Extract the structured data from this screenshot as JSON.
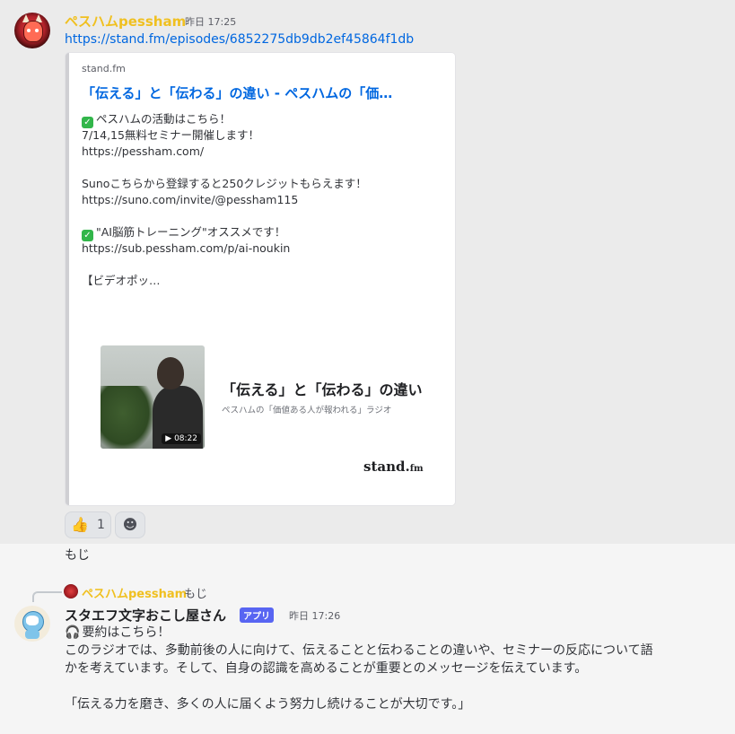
{
  "message1": {
    "username": "ペスハムpessham",
    "timestamp": "昨日 17:25",
    "link": "https://stand.fm/episodes/6852275db9db2ef45864f1db",
    "embed": {
      "provider": "stand.fm",
      "title": "「伝える」と「伝わる」の違い - ペスハムの「価…",
      "description_lines": [
        "ペスハムの活動はこちら！",
        "7/14,15無料セミナー開催します！",
        "https://pessham.com/",
        "",
        "Sunoこちらから登録すると250クレジットもらえます！",
        "https://suno.com/invite/@pessham115",
        "",
        "\"AI脳筋トレーニング\"オススメです！",
        "https://sub.pessham.com/p/ai-noukin",
        "",
        "【ビデオポッ…"
      ],
      "thumbnail": {
        "heading": "「伝える」と「伝わる」の違い",
        "subheading": "ペスハムの「価値ある人が報われる」ラジオ",
        "duration": "▶ 08:22",
        "logo": "stand.",
        "logo_small": "fm"
      }
    },
    "reactions": [
      {
        "emoji": "👍",
        "count": "1"
      }
    ],
    "add_reaction_icon": "smile-plus-icon"
  },
  "stray_text": "もじ",
  "message2": {
    "reply": {
      "username": "ペスハムpessham",
      "text": "もじ"
    },
    "username": "スタエフ文字おこし屋さん",
    "tag": "アプリ",
    "timestamp": "昨日 17:26",
    "lines": [
      "要約はこちら！",
      "このラジオでは、多動前後の人に向けて、伝えることと伝わることの違いや、セミナーの反応について語",
      "かを考えています。そして、自身の認識を高めることが重要とのメッセージを伝えています。",
      "",
      "「伝える力を磨き、多くの人に届くよう努力し続けることが大切です。」"
    ]
  },
  "colors": {
    "username": "#f0c020",
    "link": "#0067e0",
    "app_tag": "#5865f2"
  }
}
